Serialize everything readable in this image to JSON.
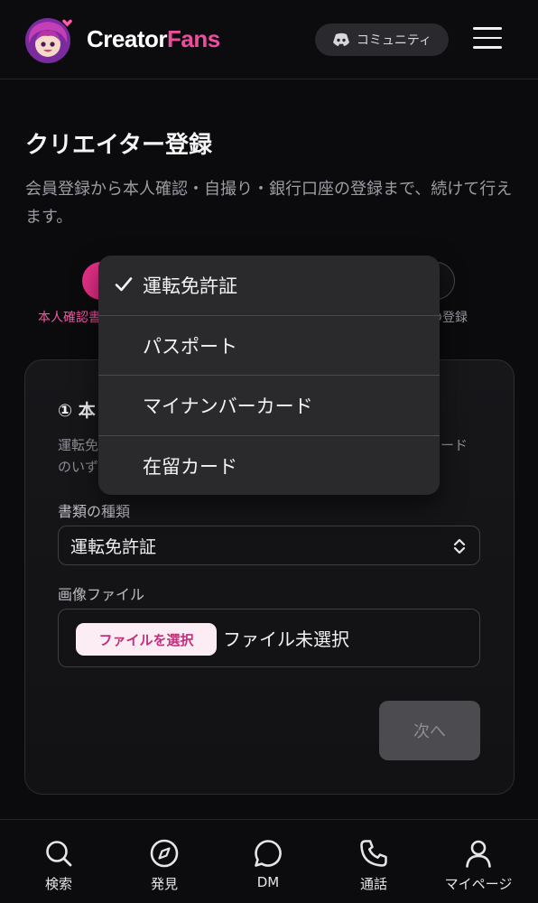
{
  "header": {
    "brand_part1": "Creator",
    "brand_part2": "Fans",
    "community_label": "コミュニティ",
    "colors": {
      "brand_accent": "#ec4d9c",
      "background": "#0c0c0e"
    },
    "icons": [
      "avatar-logo-icon",
      "discord-icon",
      "hamburger-menu-icon"
    ]
  },
  "page": {
    "title": "クリエイター登録",
    "description": "会員登録から本人確認・自撮り・銀行口座の登録まで、続けて行えます。"
  },
  "steps": {
    "left_label": "本人確認書",
    "right_label": "座の登録",
    "current_step_color": "#e8308a"
  },
  "card": {
    "heading": "① 本",
    "desc_line1": "運転免",
    "desc_line1_tail": "ード",
    "desc_line2": "のいず",
    "doc_type_label": "書類の種類",
    "doc_type_value": "運転免許証",
    "image_file_label": "画像ファイル",
    "file_button_label": "ファイルを選択",
    "file_status": "ファイル未選択",
    "next_button_label": "次へ"
  },
  "dropdown": {
    "selected": "運転免許証",
    "options": [
      "運転免許証",
      "パスポート",
      "マイナンバーカード",
      "在留カード"
    ]
  },
  "bottom_nav": {
    "items": [
      {
        "label": "検索",
        "icon": "search-icon"
      },
      {
        "label": "発見",
        "icon": "compass-icon"
      },
      {
        "label": "DM",
        "icon": "chat-bubble-icon"
      },
      {
        "label": "通話",
        "icon": "phone-icon"
      },
      {
        "label": "マイページ",
        "icon": "user-icon"
      }
    ]
  }
}
